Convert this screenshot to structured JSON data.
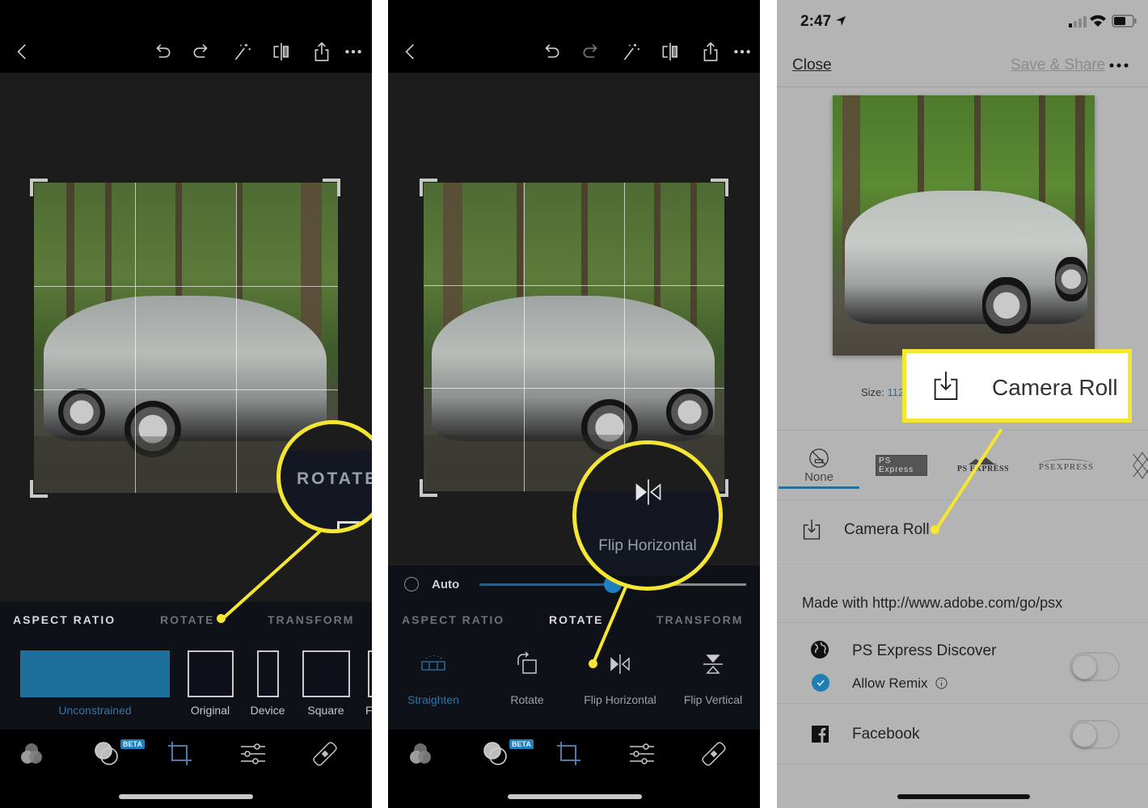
{
  "panel1": {
    "toolbar": {
      "icons": [
        "back-chevron",
        "undo",
        "redo",
        "magic-wand",
        "compare",
        "share",
        "more"
      ]
    },
    "tabs": [
      {
        "label": "ASPECT RATIO",
        "active": true
      },
      {
        "label": "ROTATE",
        "active": false
      },
      {
        "label": "TRANSFORM",
        "active": false
      }
    ],
    "ratios": [
      {
        "label": "Unconstrained",
        "selected": true
      },
      {
        "label": "Original",
        "selected": false
      },
      {
        "label": "Device",
        "selected": false
      },
      {
        "label": "Square",
        "selected": false
      },
      {
        "label": "F",
        "selected": false
      }
    ],
    "callout": {
      "text": "ROTATE"
    },
    "nav": {
      "beta_badge": "BETA",
      "items": [
        "looks",
        "blend",
        "crop",
        "adjustments",
        "heal"
      ],
      "active": "crop"
    }
  },
  "panel2": {
    "toolbar": {
      "icons": [
        "back-chevron",
        "undo",
        "redo",
        "magic-wand",
        "compare",
        "share",
        "more"
      ]
    },
    "auto_label": "Auto",
    "straighten_value_fraction": 0.5,
    "tabs": [
      {
        "label": "ASPECT RATIO",
        "active": false
      },
      {
        "label": "ROTATE",
        "active": true
      },
      {
        "label": "TRANSFORM",
        "active": false
      }
    ],
    "tools": [
      {
        "label": "Straighten",
        "icon": "straighten",
        "active": true
      },
      {
        "label": "Rotate",
        "icon": "rotate",
        "active": false
      },
      {
        "label": "Flip Horizontal",
        "icon": "flip-horizontal",
        "active": false
      },
      {
        "label": "Flip Vertical",
        "icon": "flip-vertical",
        "active": false
      }
    ],
    "callout": {
      "text": "Flip Horizontal"
    },
    "nav": {
      "beta_badge": "BETA",
      "items": [
        "looks",
        "blend",
        "crop",
        "adjustments",
        "heal"
      ],
      "active": "crop"
    }
  },
  "panel3": {
    "status": {
      "time": "2:47"
    },
    "header": {
      "close_label": "Close",
      "save_share_label": "Save & Share"
    },
    "size_label": "Size:",
    "size_value": "112",
    "callout": {
      "text": "Camera Roll"
    },
    "watermarks": [
      {
        "label": "None",
        "selected": true
      },
      {
        "label": "PS Express",
        "selected": false
      },
      {
        "label": "PS EXPRESS",
        "selected": false
      },
      {
        "label": "PSEXPRESS",
        "selected": false
      }
    ],
    "camera_roll_label": "Camera Roll",
    "made_with": "Made with http://www.adobe.com/go/psx",
    "discover_label": "PS Express Discover",
    "discover_on": false,
    "allow_remix_label": "Allow Remix",
    "allow_remix_checked": true,
    "facebook_label": "Facebook",
    "facebook_on": false
  },
  "colors": {
    "accent_blue": "#1f80c0",
    "callout_yellow": "#f5e633"
  }
}
